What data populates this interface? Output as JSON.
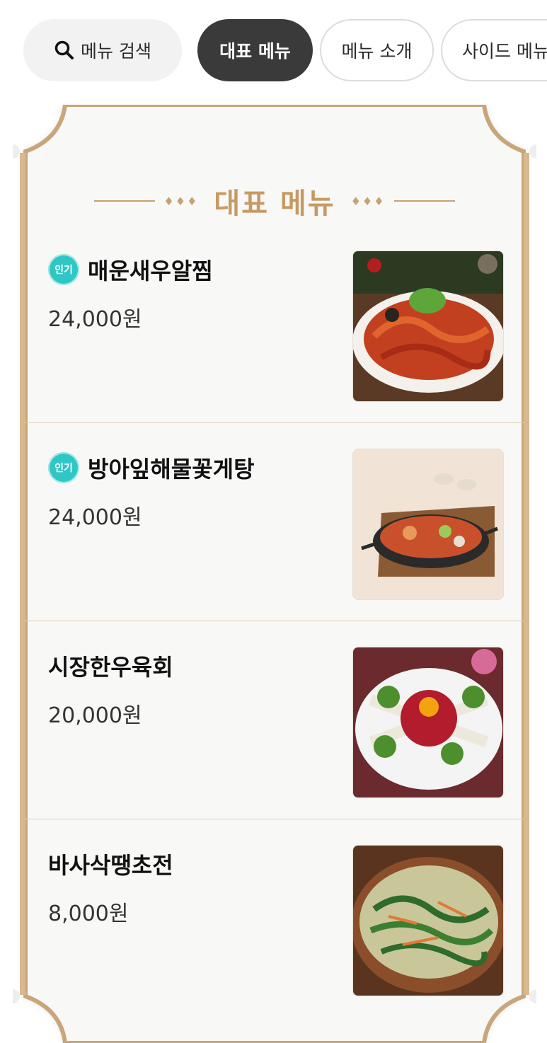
{
  "tabs": {
    "search_label": "메뉴 검색",
    "items": [
      {
        "label": "대표 메뉴",
        "active": true
      },
      {
        "label": "메뉴 소개",
        "active": false
      },
      {
        "label": "사이드 메뉴",
        "active": false
      }
    ]
  },
  "board": {
    "title": "대표 메뉴",
    "ornament": "♦♦♦",
    "menu_items": [
      {
        "name": "매운새우알찜",
        "price": "24,000원",
        "badge": "인기",
        "image": "spicy-shrimp-roe-dish-image"
      },
      {
        "name": "방아잎해물꽃게탕",
        "price": "24,000원",
        "badge": "인기",
        "image": "seafood-crab-stew-image"
      },
      {
        "name": "시장한우육회",
        "price": "20,000원",
        "badge": "",
        "image": "beef-tartare-image"
      },
      {
        "name": "바사삭땡초전",
        "price": "8,000원",
        "badge": "",
        "image": "chili-pancake-image"
      }
    ]
  },
  "colors": {
    "accent_gold": "#c79a63",
    "active_tab": "#3a3a3a",
    "badge_teal": "#2ec7c5"
  }
}
